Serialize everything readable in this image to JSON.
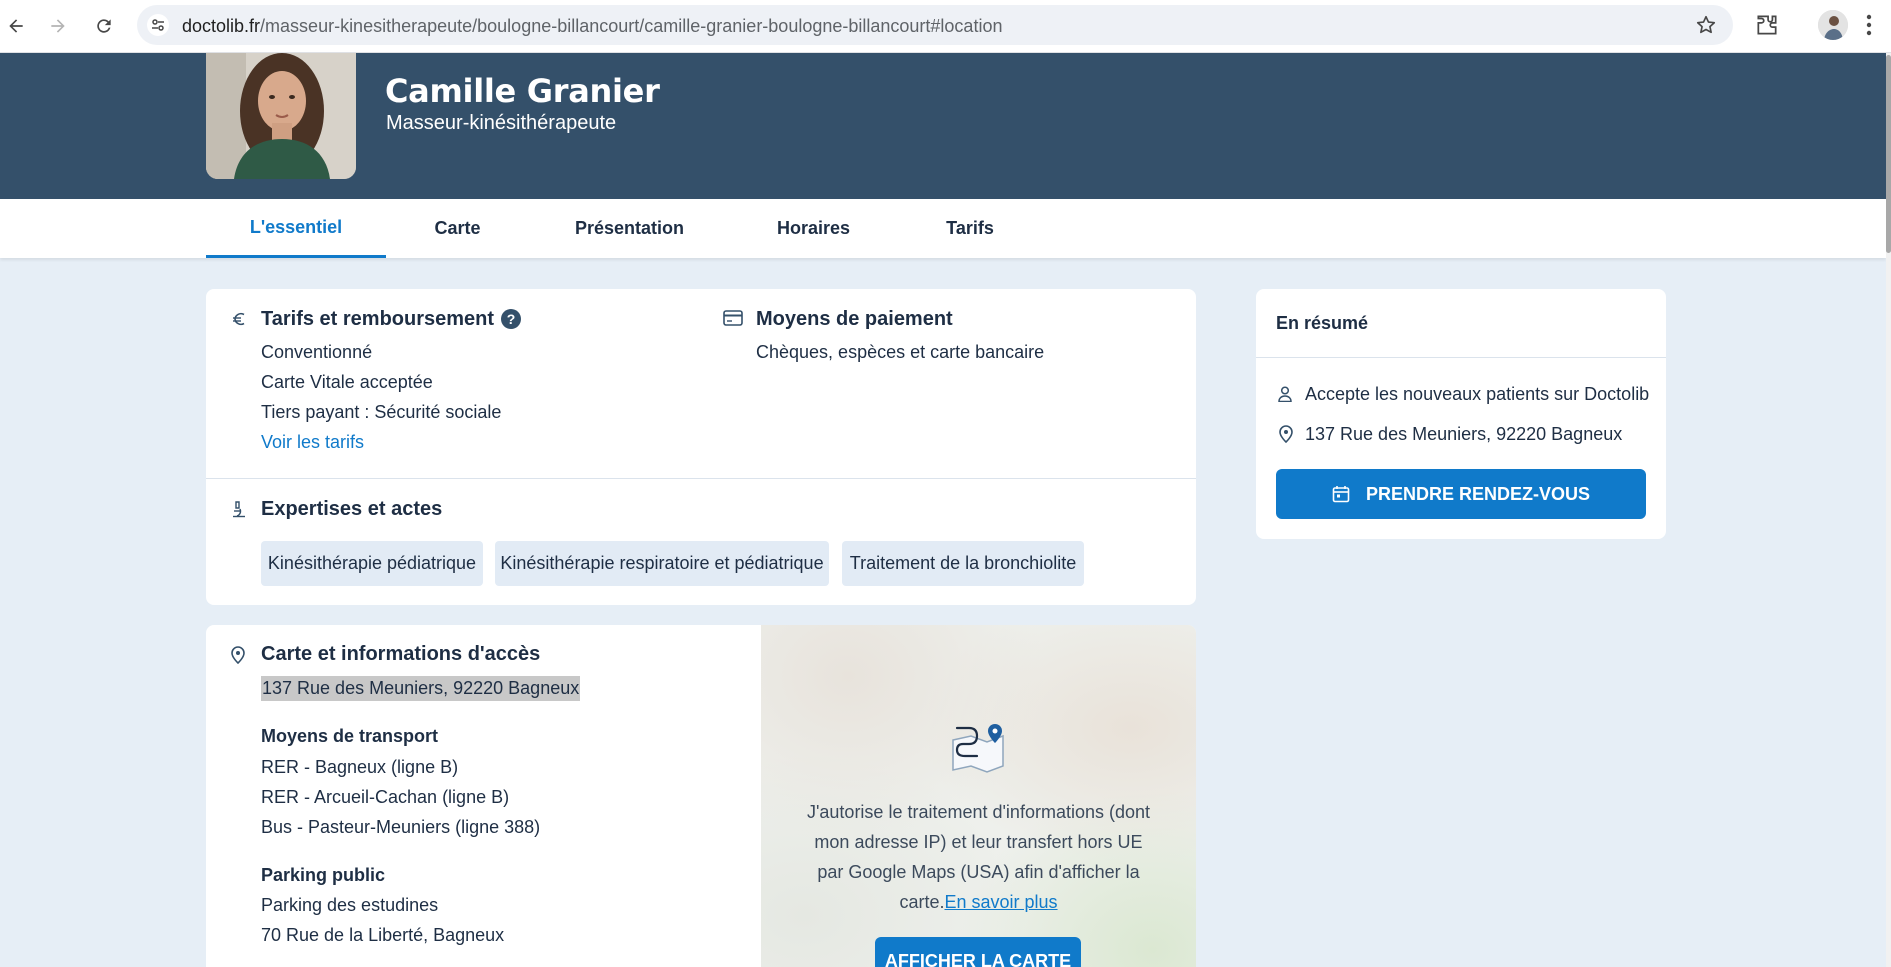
{
  "browser": {
    "url_host": "doctolib.fr",
    "url_path": "/masseur-kinesitherapeute/boulogne-billancourt/camille-granier-boulogne-billancourt#location"
  },
  "doctor": {
    "name": "Camille Granier",
    "specialty": "Masseur-kinésithérapeute"
  },
  "tabs": [
    {
      "label": "L'essentiel",
      "active": true
    },
    {
      "label": "Carte"
    },
    {
      "label": "Présentation"
    },
    {
      "label": "Horaires"
    },
    {
      "label": "Tarifs"
    }
  ],
  "tarifs": {
    "title": "Tarifs et remboursement",
    "lines": [
      "Conventionné",
      "Carte Vitale acceptée",
      "Tiers payant : Sécurité sociale"
    ],
    "link": "Voir les tarifs"
  },
  "paiement": {
    "title": "Moyens de paiement",
    "text": "Chèques, espèces et carte bancaire"
  },
  "expertises": {
    "title": "Expertises et actes",
    "tags": [
      "Kinésithérapie pédiatrique",
      "Kinésithérapie respiratoire et pédiatrique",
      "Traitement de la bronchiolite"
    ]
  },
  "acces": {
    "title": "Carte et informations d'accès",
    "address": "137 Rue des Meuniers, 92220 Bagneux",
    "transport_title": "Moyens de transport",
    "transport": [
      "RER - Bagneux (ligne B)",
      "RER - Arcueil-Cachan (ligne B)",
      "Bus - Pasteur-Meuniers (ligne 388)"
    ],
    "parking_title": "Parking public",
    "parking": [
      "Parking des estudines",
      "70 Rue de la Liberté, Bagneux"
    ]
  },
  "map": {
    "consent_text": "J'autorise le traitement d'informations (dont mon adresse IP) et leur transfert hors UE par Google Maps (USA) afin d'afficher la carte.",
    "consent_link": "En savoir plus",
    "button": "AFFICHER LA CARTE"
  },
  "summary": {
    "title": "En résumé",
    "new_patients": "Accepte les nouveaux patients sur Doctolib",
    "address": "137 Rue des Meuniers, 92220 Bagneux",
    "button": "PRENDRE RENDEZ-VOUS"
  },
  "colors": {
    "header_bg": "#34506a",
    "accent": "#107aca",
    "page_bg": "#e6eef6"
  }
}
